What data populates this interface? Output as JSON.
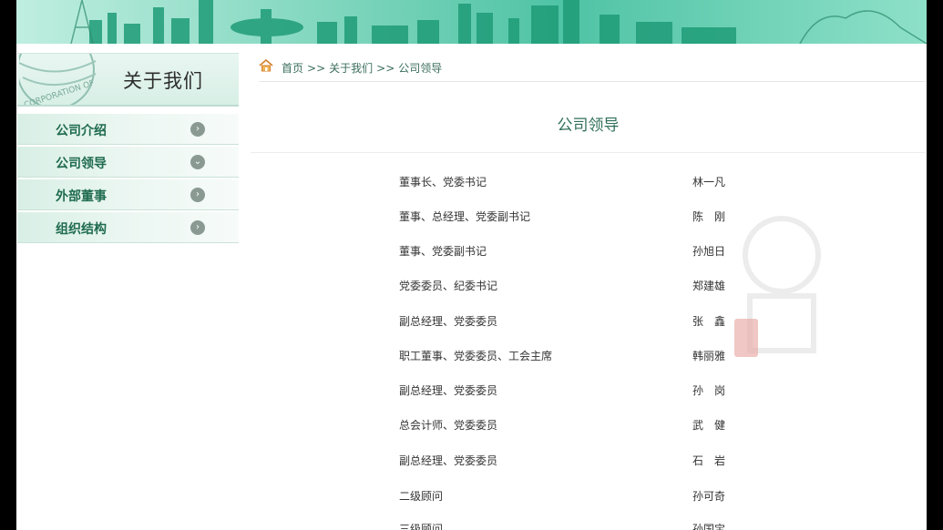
{
  "sidebar": {
    "title": "关于我们",
    "logo_text": "CORPORATION OF",
    "items": [
      {
        "label": "公司介绍",
        "icon": "chevron-right-icon",
        "glyph": "›"
      },
      {
        "label": "公司领导",
        "icon": "chevron-down-icon",
        "glyph": "⌄"
      },
      {
        "label": "外部董事",
        "icon": "chevron-right-icon",
        "glyph": "›"
      },
      {
        "label": "组织结构",
        "icon": "chevron-right-icon",
        "glyph": "›"
      }
    ]
  },
  "breadcrumb": {
    "home_icon": "home-icon",
    "items": [
      "首页",
      "关于我们",
      "公司领导"
    ],
    "separator": ">>"
  },
  "content": {
    "title": "公司领导",
    "leaders": [
      {
        "position": "董事长、党委书记",
        "name": "林一凡"
      },
      {
        "position": "董事、总经理、党委副书记",
        "name": "陈　刚"
      },
      {
        "position": "董事、党委副书记",
        "name": "孙旭日"
      },
      {
        "position": "党委委员、纪委书记",
        "name": "郑建雄"
      },
      {
        "position": "副总经理、党委委员",
        "name": "张　鑫"
      },
      {
        "position": "职工董事、党委委员、工会主席",
        "name": "韩丽雅"
      },
      {
        "position": "副总经理、党委委员",
        "name": "孙　岗"
      },
      {
        "position": "总会计师、党委委员",
        "name": "武　健"
      },
      {
        "position": "副总经理、党委委员",
        "name": "石　岩"
      },
      {
        "position": "二级顾问",
        "name": "孙可奇"
      },
      {
        "position": "三级顾问",
        "name": "孙国宝"
      }
    ]
  },
  "colors": {
    "accent": "#2f6f5a",
    "menu_text": "#1f6b4f",
    "banner": "#4fc3a5"
  }
}
